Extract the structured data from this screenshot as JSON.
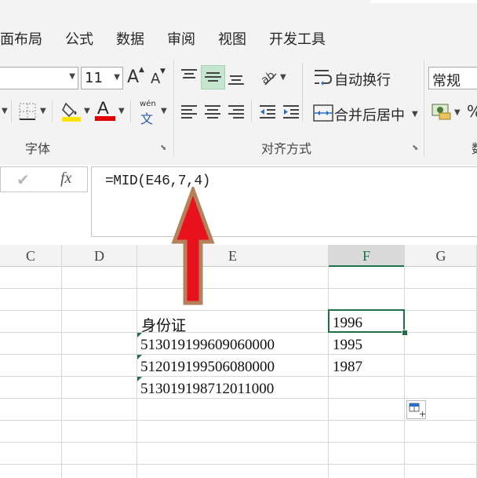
{
  "tabs": [
    "面布局",
    "公式",
    "数据",
    "审阅",
    "视图",
    "开发工具"
  ],
  "ribbon": {
    "font_size": "11",
    "wrap_label": "自动换行",
    "merge_label": "合并后居中",
    "number_format": "常规",
    "group_font": "字体",
    "group_align": "对齐方式",
    "group_number_partial": "数",
    "phonetic_top": "wén",
    "phonetic_bottom": "文",
    "inc_font": "A",
    "dec_font": "A",
    "font_color_letter": "A",
    "percent": "%"
  },
  "formula_bar": {
    "fx": "fx",
    "formula": "=MID(E46,7,4)"
  },
  "columns": [
    "C",
    "D",
    "E",
    "F",
    "G"
  ],
  "cells": {
    "e_header": "身份证",
    "e_row1": "513019199609060000",
    "e_row2": "512019199506080000",
    "e_row3": "513019198712011000",
    "f_header": "1996",
    "f_row1": "1995",
    "f_row2": "1987"
  },
  "colors": {
    "fill_highlight": "#ffe400",
    "font_color": "#e00000",
    "active_green": "#1e7145",
    "arrow_red": "#e8121c",
    "arrow_border": "#b5805c"
  }
}
